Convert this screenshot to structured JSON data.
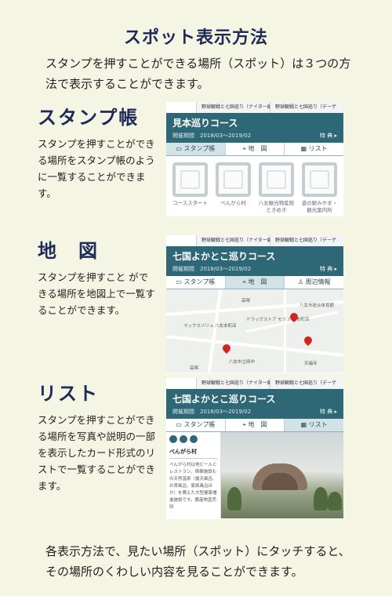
{
  "page": {
    "title": "スポット表示方法",
    "intro": "スタンプを押すことができる場所（スポット）は３つの方法で表示することができます。",
    "outro": "各表示方法で、見たい場所（スポット）にタッチすると、その場所のくわしい内容を見ることができます。"
  },
  "sections": [
    {
      "title": "スタンプ帳",
      "desc": "スタンプを押すことができる場所をスタンプ帳のように一覧することができます。"
    },
    {
      "title": "地　図",
      "desc": "スタンプを押すこと ができる場所を地図上で一覧することができます。"
    },
    {
      "title": "リスト",
      "desc": "スタンプを押すことができる場所を写真や説明の一部を表示したカード形式のリストで一覧することができます。"
    }
  ],
  "screens": {
    "stampbook": {
      "tabs": [
        "野球観戦と七国巡り（ナイター編）",
        "野球観戦と七国巡り（デーゲ"
      ],
      "course": "見本巡りコース",
      "period": "開催期間　2018/03〜2019/02",
      "perk": "特 典 ▸",
      "modes": [
        "スタンプ帳",
        "地　図",
        "リスト"
      ],
      "stamps": [
        "コーススタート",
        "べんがら村",
        "八女観光物産館ときめき",
        "道の駅みやま・観光案内所"
      ]
    },
    "map": {
      "tabs": [
        "野球観戦と七国巡り（ナイター編）",
        "野球観戦と七国巡り（デーゲ"
      ],
      "course": "七国よかとこ巡りコース",
      "period": "開催期間　2018/03〜2019/02",
      "perk": "特 典 ▸",
      "modes": [
        "スタンプ帳",
        "地　図",
        "周辺情報"
      ],
      "labels": [
        "高塚",
        "八女市総合体育館",
        "ドラッグストア モリ 八女本町店",
        "マックスバリュ 八女本町店",
        "八女市立岡中",
        "天福寺",
        "高塚"
      ]
    },
    "list": {
      "tabs": [
        "野球観戦と七国巡り（ナイター編）",
        "野球観戦と七国巡り（デーゲ"
      ],
      "course": "七国よかとこ巡りコース",
      "period": "開催期間　2018/03〜2019/02",
      "perk": "特 典 ▸",
      "modes": [
        "スタンプ帳",
        "地　図",
        "リスト"
      ],
      "spot_name": "べんがら村",
      "spot_desc": "べんがら村は地ビールとレストラン、宿棟施設もの天然温泉（露天風呂、お茶風呂、家族風呂ほか）を備えた大型健康増進施設です。農産物直売所"
    }
  }
}
